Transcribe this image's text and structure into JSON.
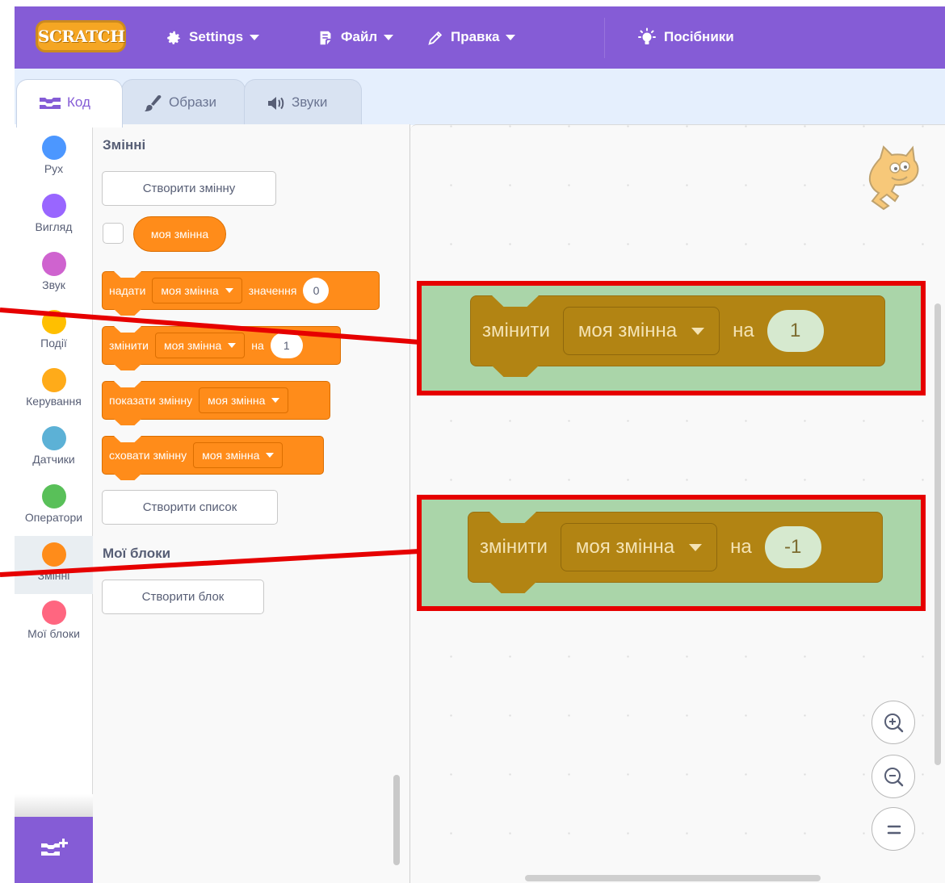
{
  "menu": {
    "logo_text": "SCRATCH",
    "settings": "Settings",
    "file": "Файл",
    "edit": "Правка",
    "tutorials": "Посібники"
  },
  "tabs": [
    {
      "label": "Код"
    },
    {
      "label": "Образи"
    },
    {
      "label": "Звуки"
    }
  ],
  "categories": [
    {
      "label": "Рух",
      "color": "#4c97ff"
    },
    {
      "label": "Вигляд",
      "color": "#9966ff"
    },
    {
      "label": "Звук",
      "color": "#cf63cf"
    },
    {
      "label": "Події",
      "color": "#ffbf00"
    },
    {
      "label": "Керування",
      "color": "#ffab19"
    },
    {
      "label": "Датчики",
      "color": "#5cb1d6"
    },
    {
      "label": "Оператори",
      "color": "#59c059"
    },
    {
      "label": "Змінні",
      "color": "#ff8c1a"
    },
    {
      "label": "Мої блоки",
      "color": "#ff6680"
    }
  ],
  "palette": {
    "variables_title": "Змінні",
    "make_variable": "Створити змінну",
    "variable_reporter": "моя змінна",
    "set_block": {
      "verb": "надати",
      "var": "моя змінна",
      "word": "значення",
      "value": "0"
    },
    "change_block": {
      "verb": "змінити",
      "var": "моя змінна",
      "word": "на",
      "value": "1"
    },
    "show_block": {
      "verb": "показати змінну",
      "var": "моя змінна"
    },
    "hide_block": {
      "verb": "сховати змінну",
      "var": "моя змінна"
    },
    "make_list": "Створити список",
    "my_blocks_title": "Мої блоки",
    "make_block": "Створити блок"
  },
  "workspace": {
    "highlight_color": "#e60000",
    "block_1": {
      "verb": "змінити",
      "var": "моя змінна",
      "word": "на",
      "value": "1"
    },
    "block_2": {
      "verb": "змінити",
      "var": "моя змінна",
      "word": "на",
      "value": "-1"
    }
  },
  "icons": {
    "settings": "gear-icon",
    "file": "file-icon",
    "edit": "pencil-icon",
    "tutorials": "lightbulb-icon",
    "zoom_in": "zoom-in-icon",
    "zoom_out": "zoom-out-icon",
    "zoom_reset": "zoom-reset-icon",
    "extension": "add-extension-icon",
    "sprite": "scratch-cat-icon"
  }
}
